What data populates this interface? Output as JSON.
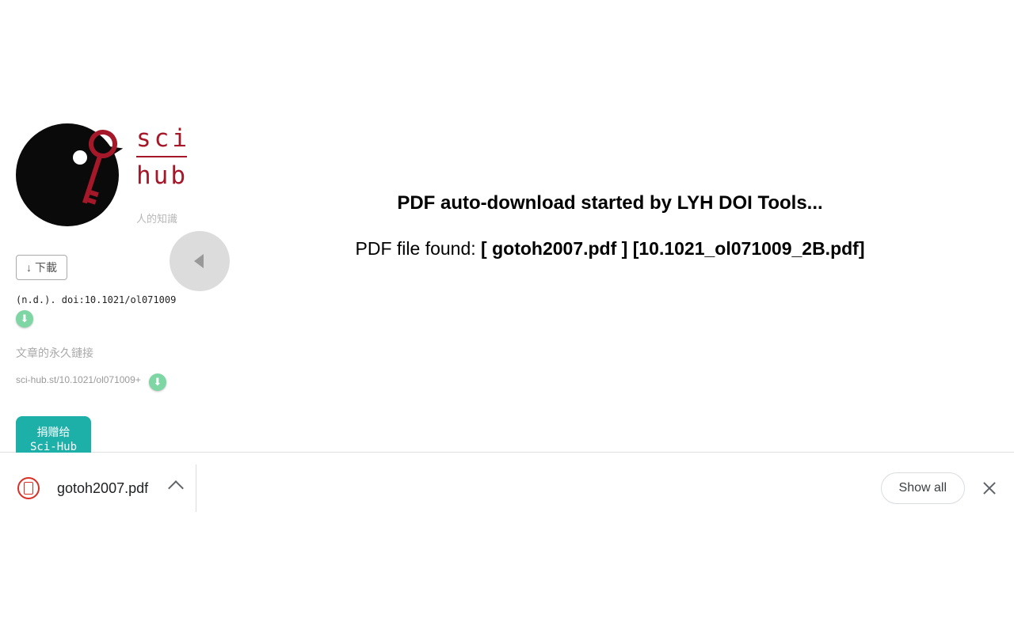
{
  "brand": {
    "line1": "sci",
    "line2": "hub",
    "tagline": "人的知識"
  },
  "sidebar": {
    "download_label": "下載",
    "citation": "(n.d.). doi:10.1021/ol071009",
    "permalink_label": "文章的永久鏈接",
    "permalink": "sci-hub.st/10.1021/ol071009+",
    "donate_line1": "捐赠给",
    "donate_line2": "Sci-Hub"
  },
  "main": {
    "line1": "PDF auto-download started by LYH DOI Tools...",
    "line2_prefix": "PDF file found: ",
    "line2_bold": "[ gotoh2007.pdf ] [10.1021_ol071009_2B.pdf]"
  },
  "download_bar": {
    "filename": "gotoh2007.pdf",
    "show_all": "Show all"
  }
}
